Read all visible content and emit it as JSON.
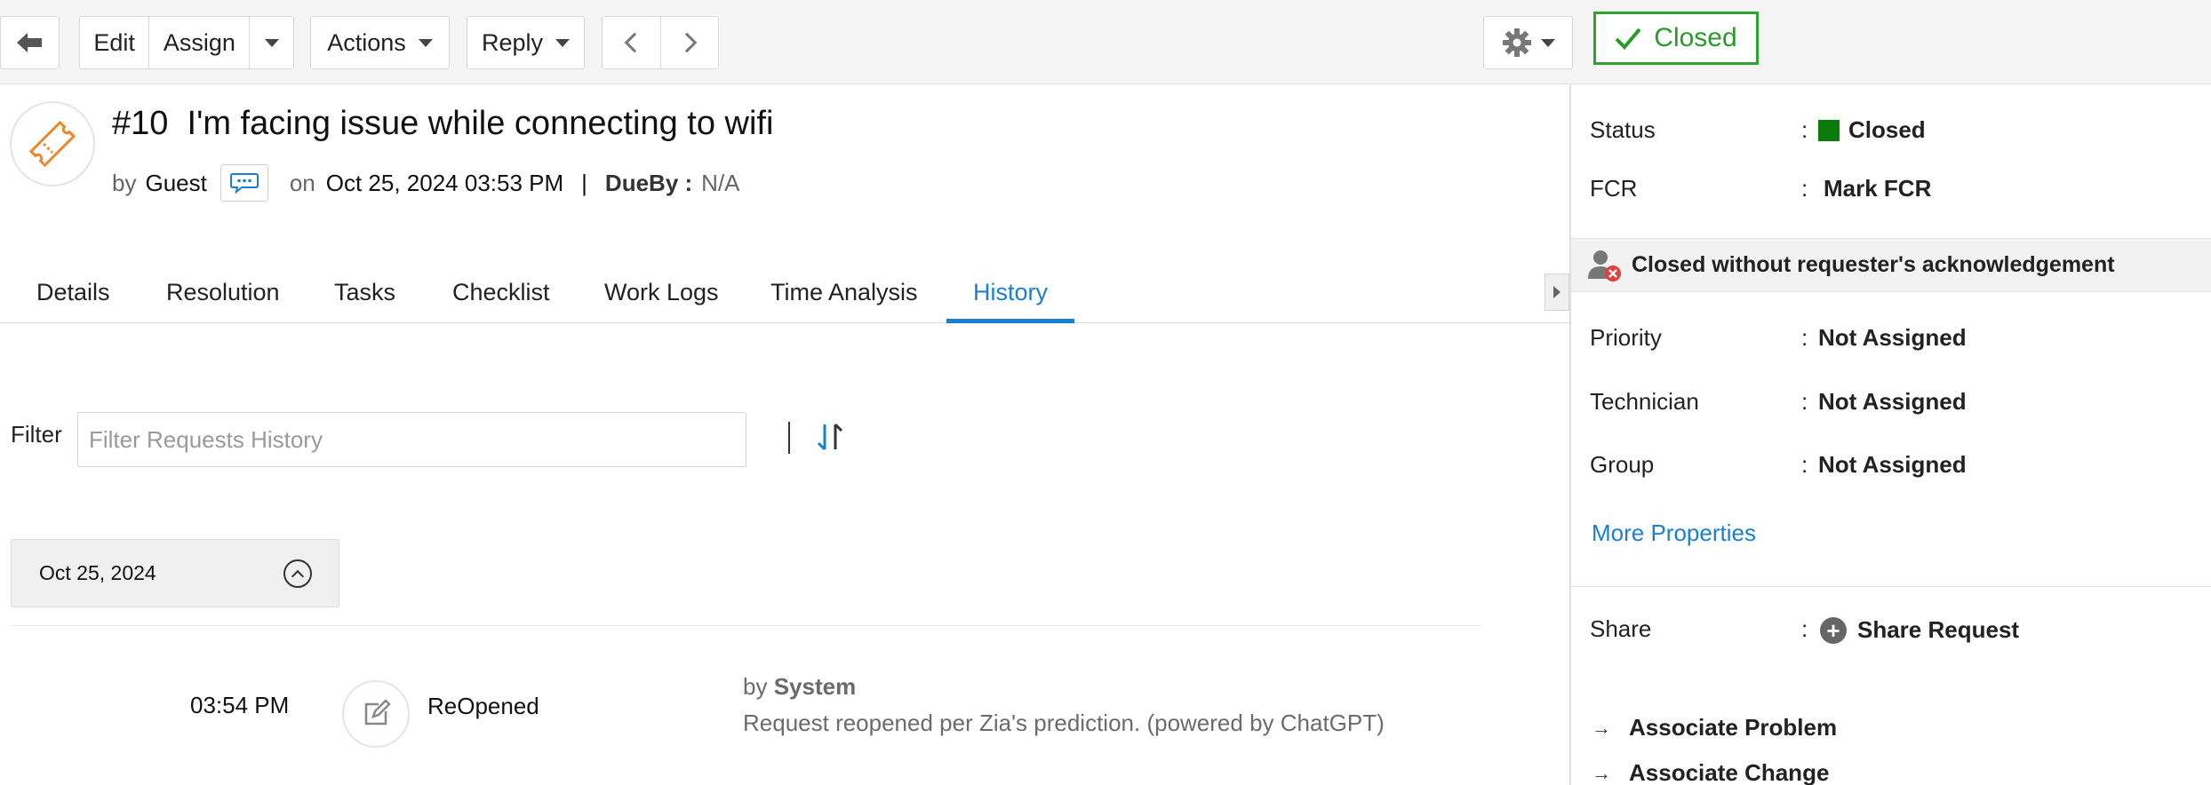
{
  "toolbar": {
    "back_icon": "arrow-left-icon",
    "edit_label": "Edit",
    "assign_label": "Assign",
    "actions_label": "Actions",
    "reply_label": "Reply",
    "settings_icon": "gear-icon",
    "status_button_label": "Closed",
    "status_color": "#2ea52e"
  },
  "ticket": {
    "number": "#10",
    "subject": "I'm facing issue while connecting to wifi",
    "by_prefix": "by",
    "requester": "Guest",
    "on_prefix": "on",
    "created": "Oct 25, 2024 03:53 PM",
    "separator": "|",
    "dueby_label": "DueBy :",
    "dueby_value": "N/A"
  },
  "tabs": [
    {
      "label": "Details"
    },
    {
      "label": "Resolution"
    },
    {
      "label": "Tasks"
    },
    {
      "label": "Checklist"
    },
    {
      "label": "Work Logs"
    },
    {
      "label": "Time Analysis"
    },
    {
      "label": "History",
      "active": true
    }
  ],
  "filter": {
    "label": "Filter",
    "placeholder": "Filter Requests History",
    "value": ""
  },
  "history": {
    "date_group": "Oct 25, 2024",
    "entries": [
      {
        "time": "03:54 PM",
        "action": "ReOpened",
        "by_prefix": "by",
        "by": "System",
        "description": "Request reopened per Zia's prediction. (powered by ChatGPT)"
      }
    ]
  },
  "sidebar": {
    "status_label": "Status",
    "status_value": "Closed",
    "status_color": "#0a7a0a",
    "fcr_label": "FCR",
    "fcr_value": "Mark FCR",
    "ack_text": "Closed without requester's acknowledgement",
    "priority_label": "Priority",
    "priority_value": "Not Assigned",
    "technician_label": "Technician",
    "technician_value": "Not Assigned",
    "group_label": "Group",
    "group_value": "Not Assigned",
    "more_properties": "More Properties",
    "share_label": "Share",
    "share_value": "Share Request",
    "associate_problem": "Associate Problem",
    "associate_change": "Associate Change",
    "colon": ":"
  },
  "accent_color": "#1a7fd0"
}
